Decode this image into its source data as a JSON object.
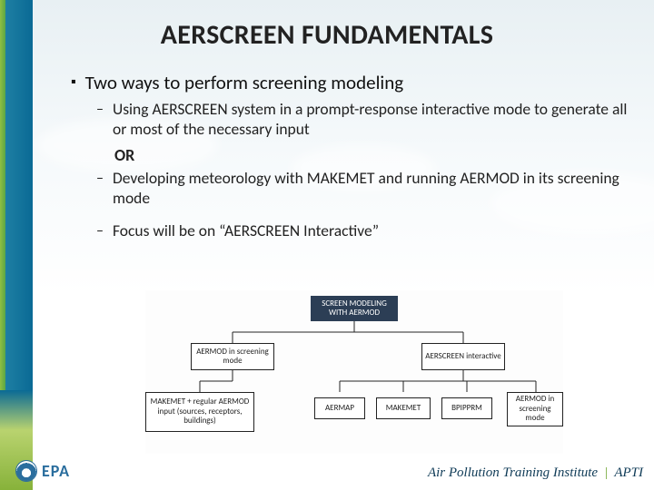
{
  "title": "AERSCREEN FUNDAMENTALS",
  "bullet1": "Two ways to perform screening modeling",
  "sub1": "Using AERSCREEN system in a prompt-response interactive mode to generate all or most of the necessary input",
  "or": "OR",
  "sub2": "Developing meteorology with MAKEMET and running AERMOD in its screening mode",
  "sub3": "Focus will be on “AERSCREEN Interactive”",
  "diagram": {
    "top": "SCREEN MODELING WITH AERMOD",
    "left_mid": "AERMOD in screening mode",
    "right_mid": "AERSCREEN interactive",
    "b1": "MAKEMET + regular AERMOD input (sources, receptors, buildings)",
    "b2": "AERMAP",
    "b3": "MAKEMET",
    "b4": "BPIPPRM",
    "b5": "AERMOD in screening mode"
  },
  "footer": {
    "org": "Air Pollution Training Institute",
    "abbr": "APTI",
    "logo_text": "EPA"
  }
}
